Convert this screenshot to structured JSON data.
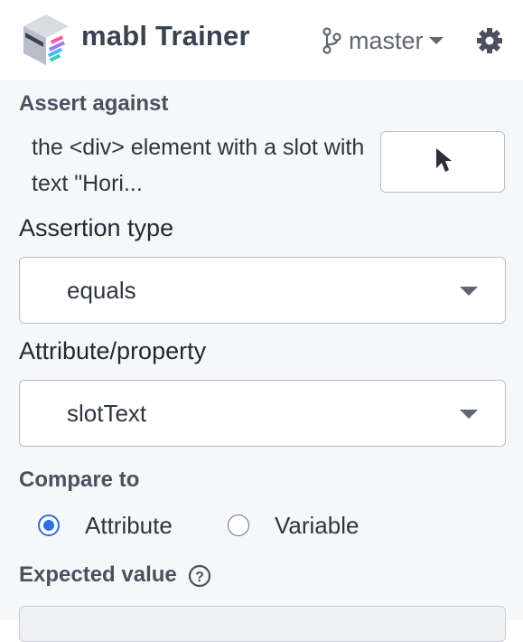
{
  "header": {
    "brand": "mabl Trainer",
    "branch": "master",
    "branch_icon": "git-branch-icon",
    "settings_icon": "gear-icon"
  },
  "assert_against": {
    "label": "Assert against",
    "description": "the <div> element with a slot with text \"Hori...",
    "picker_icon": "cursor-pointer-icon"
  },
  "assertion_type": {
    "label": "Assertion type",
    "value": "equals"
  },
  "attribute": {
    "label": "Attribute/property",
    "value": "slotText"
  },
  "compare_to": {
    "label": "Compare to",
    "options": [
      {
        "label": "Attribute",
        "checked": true
      },
      {
        "label": "Variable",
        "checked": false
      }
    ]
  },
  "expected_value": {
    "label": "Expected value",
    "help_icon": "help-icon"
  },
  "colors": {
    "accent": "#2f6fe4",
    "panel_bg": "#f6f7f9"
  }
}
